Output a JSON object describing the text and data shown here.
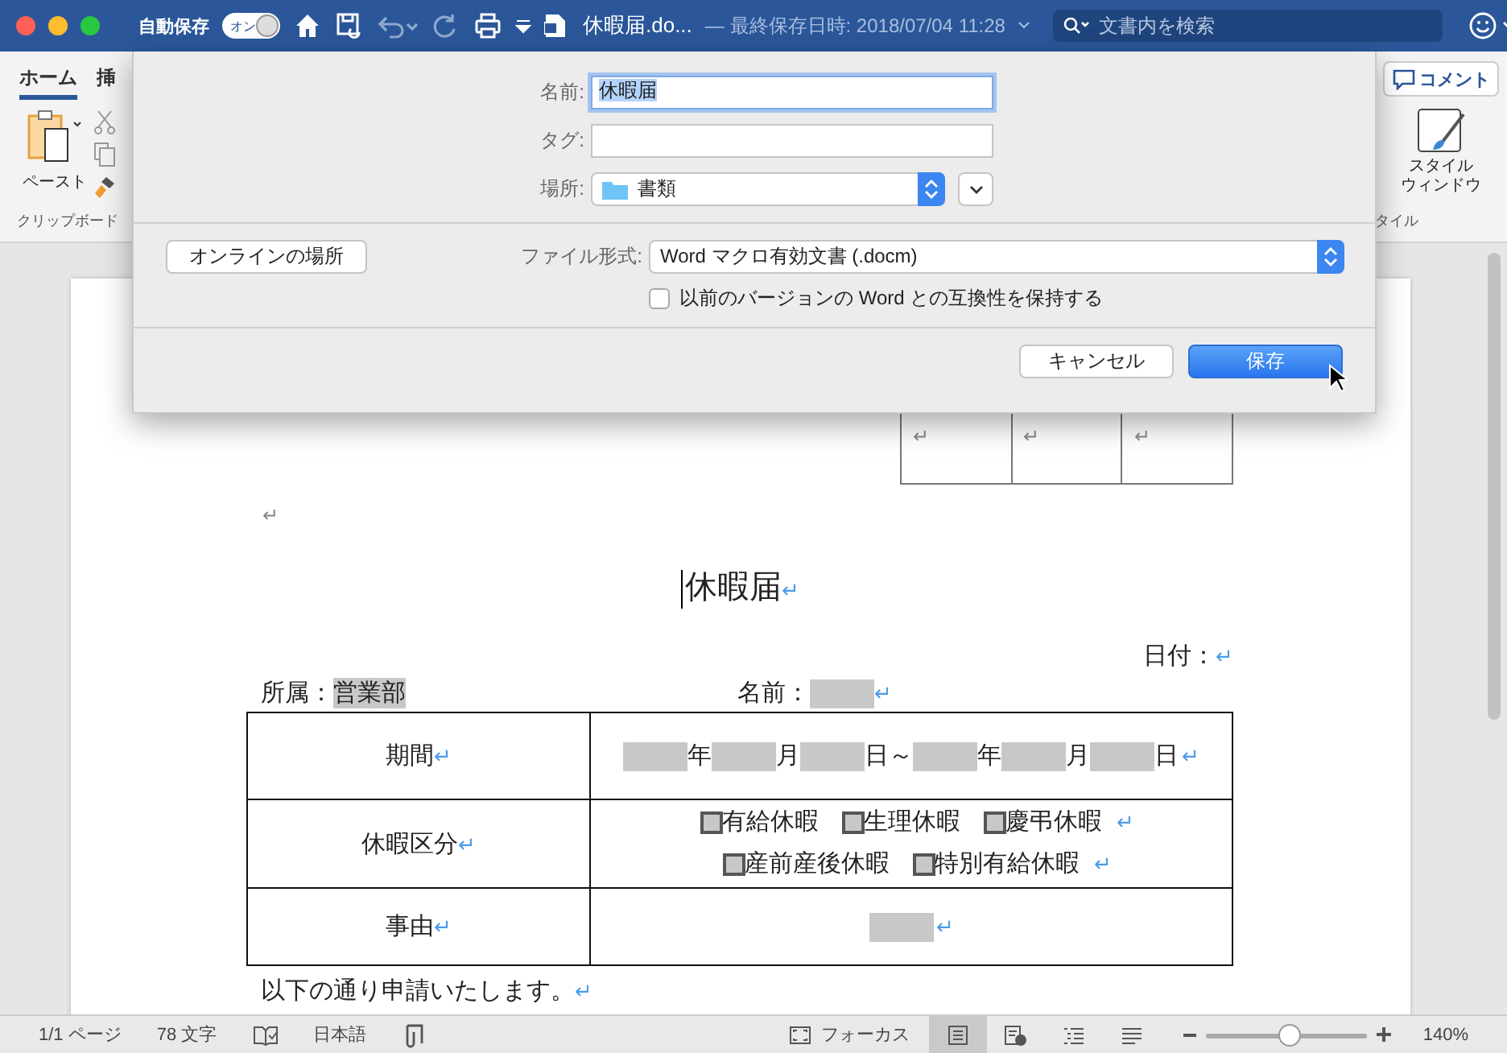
{
  "window": {
    "autosave_label": "自動保存",
    "autosave_toggle": {
      "label": "オン",
      "on": true
    },
    "title": "休暇届.do...",
    "saved": "— 最終保存日時: 2018/07/04 11:28",
    "search": {
      "placeholder": "文書内を検索"
    }
  },
  "ribbon": {
    "tabs": [
      {
        "label": "ホーム",
        "selected": true
      },
      {
        "label": "挿",
        "selected": false
      }
    ],
    "paste_label": "ペースト",
    "clipboard_group": "クリップボード",
    "comment_button": "コメント",
    "style_window_lines": [
      "スタイル",
      "ウィンドウ"
    ],
    "style_group": "タイル"
  },
  "dialog": {
    "name_label": "名前:",
    "name_value": "休暇届",
    "tag_label": "タグ:",
    "location_label": "場所:",
    "location_value": "書類",
    "online_button": "オンラインの場所",
    "format_label": "ファイル形式:",
    "format_value": "Word マクロ有効文書 (.docm)",
    "compat": {
      "label": "以前のバージョンの Word との互換性を保持する",
      "checked": false
    },
    "cancel": "キャンセル",
    "save": "保存"
  },
  "document": {
    "top_table": [
      {
        "mark": "↵"
      },
      {
        "mark": "↵"
      },
      {
        "mark": "↵"
      }
    ],
    "blank_mark": "↵",
    "title": {
      "text": "休暇届",
      "mark": "↵"
    },
    "date": {
      "text": "日付：",
      "mark": "↵"
    },
    "affiliation": {
      "label": "所属：",
      "value": "営業部"
    },
    "name": {
      "label": "名前：",
      "mark": "↵"
    },
    "table": [
      {
        "header": "期間",
        "mark": "↵",
        "lines": [
          [
            {
              "kind": "field"
            },
            {
              "kind": "text",
              "text": "年"
            },
            {
              "kind": "field"
            },
            {
              "kind": "text",
              "text": "月"
            },
            {
              "kind": "field"
            },
            {
              "kind": "text",
              "text": "日～"
            },
            {
              "kind": "field"
            },
            {
              "kind": "text",
              "text": "年"
            },
            {
              "kind": "field"
            },
            {
              "kind": "text",
              "text": "月"
            },
            {
              "kind": "field"
            },
            {
              "kind": "text",
              "text": "日"
            },
            {
              "kind": "mark",
              "text": "↵"
            }
          ]
        ]
      },
      {
        "header": "休暇区分",
        "mark": "↵",
        "lines": [
          [
            {
              "kind": "check",
              "text": "有給休暇",
              "checked": false
            },
            {
              "kind": "check",
              "text": "生理休暇",
              "checked": false
            },
            {
              "kind": "check",
              "text": "慶弔休暇",
              "checked": false
            },
            {
              "kind": "mark",
              "text": "↵"
            }
          ],
          [
            {
              "kind": "check",
              "text": "産前産後休暇",
              "checked": false
            },
            {
              "kind": "check",
              "text": "特別有給休暇",
              "checked": false
            },
            {
              "kind": "mark",
              "text": "↵"
            }
          ]
        ]
      },
      {
        "header": "事由",
        "mark": "↵",
        "lines": [
          [
            {
              "kind": "field"
            },
            {
              "kind": "mark",
              "text": "↵"
            }
          ]
        ]
      }
    ],
    "closing": {
      "text": "以下の通り申請いたします。",
      "mark": "↵"
    }
  },
  "status_bar": {
    "pages": "1/1 ページ",
    "words": "78 文字",
    "language": "日本語",
    "focus": "フォーカス",
    "views": [
      {
        "kind": "print",
        "selected": true
      },
      {
        "kind": "web",
        "selected": false
      },
      {
        "kind": "outline",
        "selected": false
      },
      {
        "kind": "draft",
        "selected": false
      }
    ],
    "zoom": {
      "level": 0.52,
      "reading": "140%"
    }
  }
}
